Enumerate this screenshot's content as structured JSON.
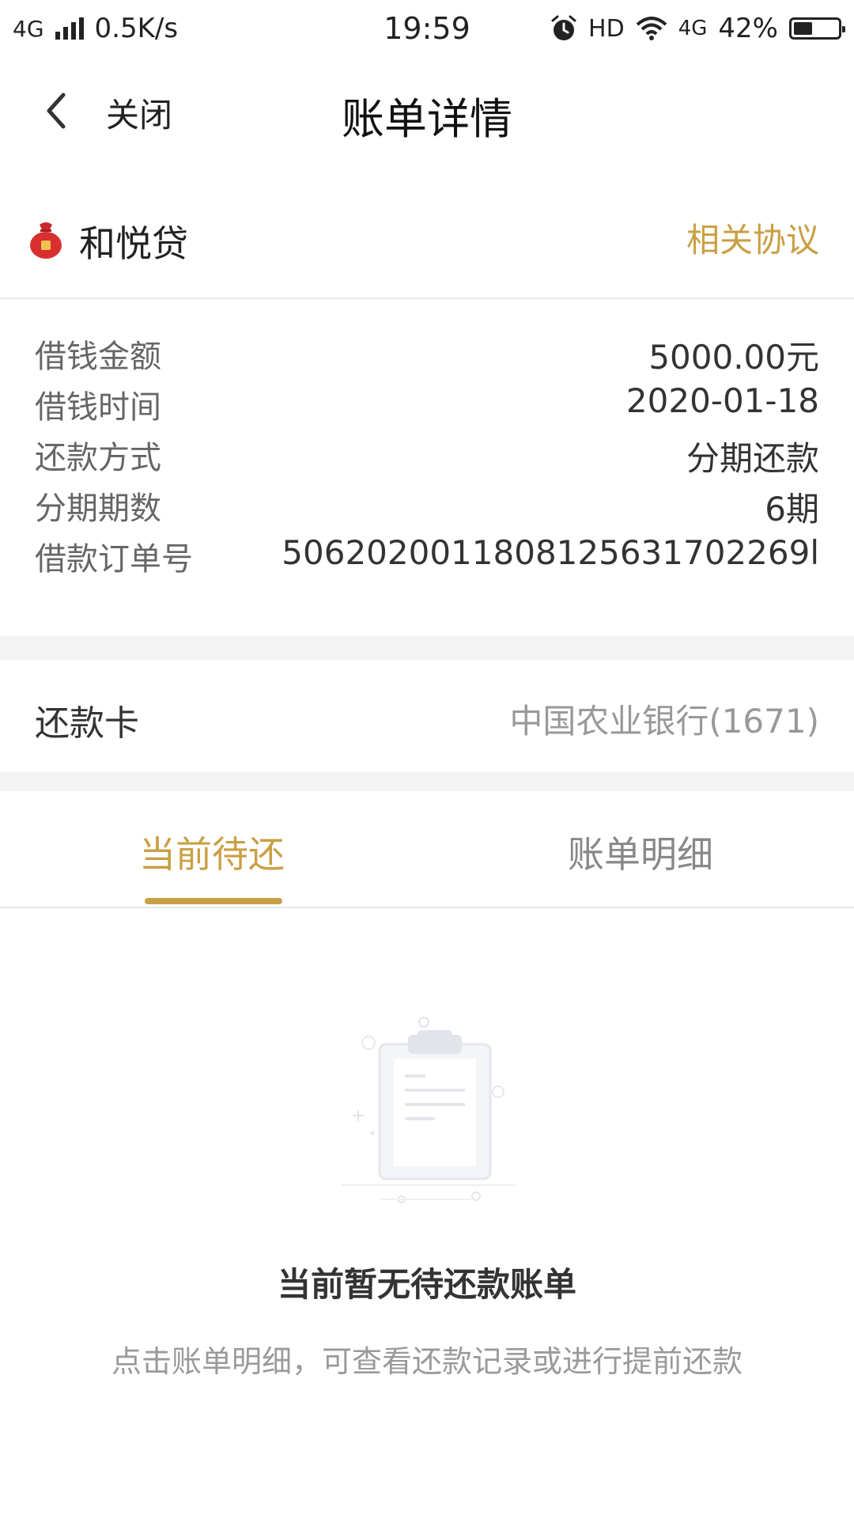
{
  "status_bar": {
    "network": "4G",
    "speed": "0.5K/s",
    "time": "19:59",
    "hd": "HD",
    "network_right": "4G",
    "battery": "42%",
    "battery_level": 0.42
  },
  "nav": {
    "close_label": "关闭",
    "title": "账单详情"
  },
  "product": {
    "name": "和悦贷",
    "agreement_link": "相关协议",
    "accent_color": "#c9a045"
  },
  "loan_info": {
    "rows": [
      {
        "label": "借钱金额",
        "value": "5000.00元"
      },
      {
        "label": "借钱时间",
        "value": "2020-01-18"
      },
      {
        "label": "还款方式",
        "value": "分期还款"
      },
      {
        "label": "分期期数",
        "value": "6期"
      },
      {
        "label": "借款订单号",
        "value": "5062020011808125631702269l"
      }
    ]
  },
  "repayment_card": {
    "label": "还款卡",
    "value": "中国农业银行(1671)"
  },
  "tabs": [
    {
      "label": "当前待还",
      "active": true
    },
    {
      "label": "账单明细",
      "active": false
    }
  ],
  "empty_state": {
    "icon": "clipboard-icon",
    "title": "当前暂无待还款账单",
    "description": "点击账单明细，可查看还款记录或进行提前还款"
  }
}
